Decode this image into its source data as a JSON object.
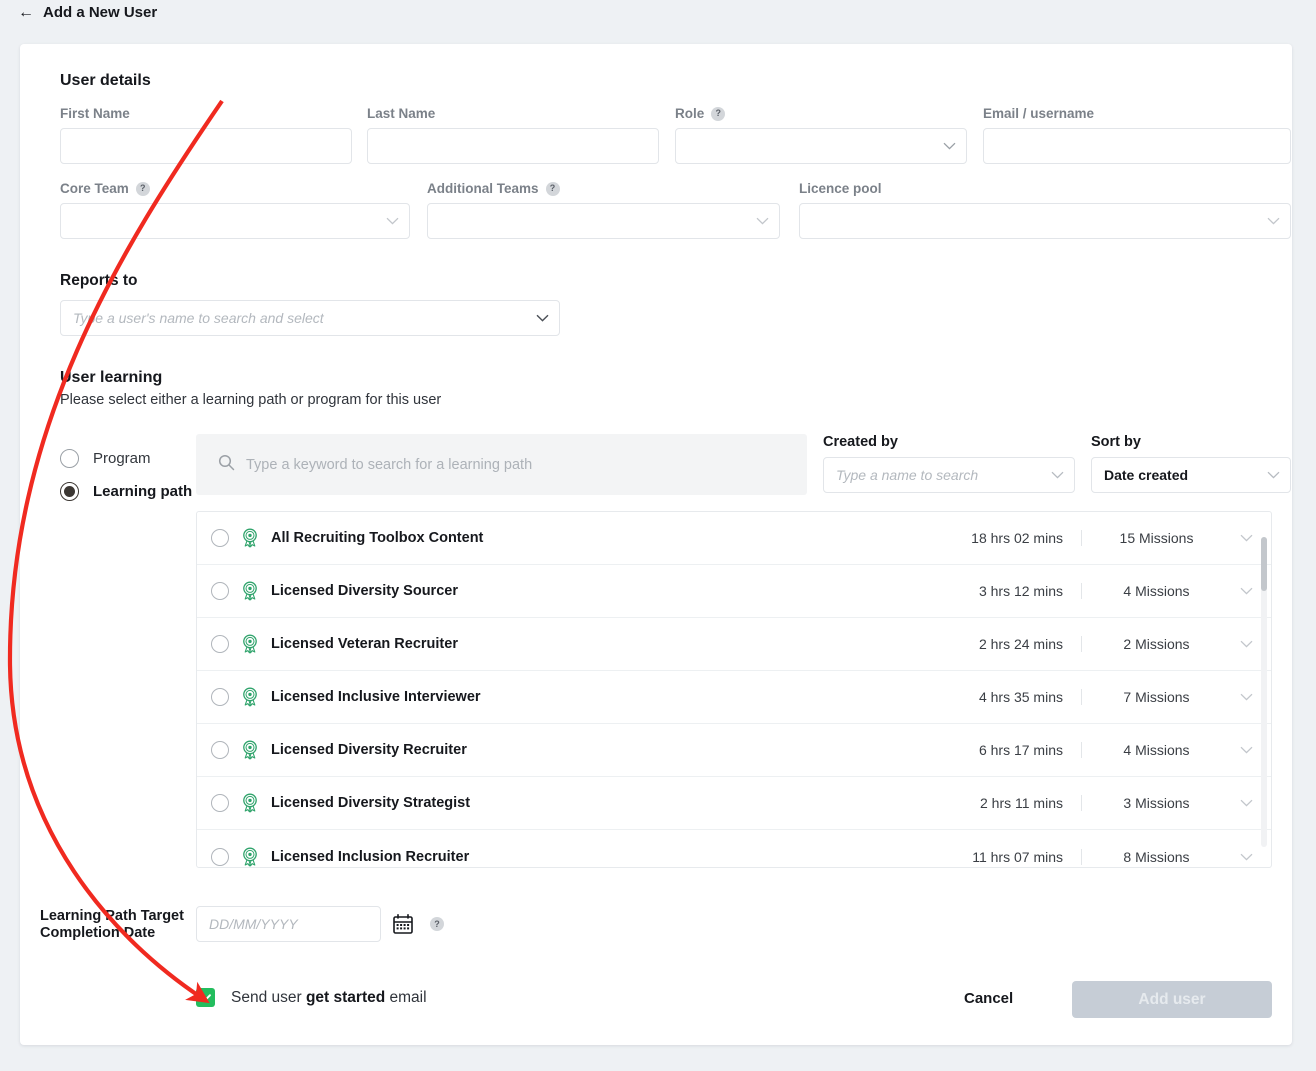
{
  "header": {
    "back_icon": "left-arrow-icon",
    "title": "Add a New User"
  },
  "user_details": {
    "section_title": "User details",
    "fields": [
      {
        "label": "First Name",
        "value": "",
        "placeholder": "",
        "type": "text",
        "help": false
      },
      {
        "label": "Last Name",
        "value": "",
        "placeholder": "",
        "type": "text",
        "help": false
      },
      {
        "label": "Role",
        "value": "",
        "placeholder": "",
        "type": "select",
        "help": true
      },
      {
        "label": "Email / username",
        "value": "",
        "placeholder": "",
        "type": "text",
        "help": false
      },
      {
        "label": "Core Team",
        "value": "",
        "placeholder": "",
        "type": "select",
        "help": true
      },
      {
        "label": "Additional Teams",
        "value": "",
        "placeholder": "",
        "type": "select",
        "help": true
      },
      {
        "label": "Licence pool",
        "value": "",
        "placeholder": "",
        "type": "select",
        "help": false
      }
    ]
  },
  "reports_to": {
    "label": "Reports to",
    "value": "",
    "placeholder": "Type a user's name to search and select"
  },
  "user_learning": {
    "section_title": "User learning",
    "subtitle": "Please select either a learning path or program for this user",
    "options": [
      {
        "label": "Program",
        "selected": false
      },
      {
        "label": "Learning path",
        "selected": true
      }
    ],
    "search": {
      "icon": "search-icon",
      "value": "",
      "placeholder": "Type a keyword to search for a learning path"
    },
    "created_by": {
      "label": "Created by",
      "value": "",
      "placeholder": "Type a name to search"
    },
    "sort_by": {
      "label": "Sort by",
      "value": "Date created"
    },
    "paths": [
      {
        "name": "All Recruiting Toolbox Content",
        "duration": "18 hrs 02 mins",
        "missions": "15 Missions",
        "selected": false
      },
      {
        "name": "Licensed Diversity Sourcer",
        "duration": "3 hrs 12 mins",
        "missions": "4 Missions",
        "selected": false
      },
      {
        "name": "Licensed Veteran Recruiter",
        "duration": "2 hrs 24 mins",
        "missions": "2 Missions",
        "selected": false
      },
      {
        "name": "Licensed Inclusive Interviewer",
        "duration": "4 hrs 35 mins",
        "missions": "7 Missions",
        "selected": false
      },
      {
        "name": "Licensed Diversity Recruiter",
        "duration": "6 hrs 17 mins",
        "missions": "4 Missions",
        "selected": false
      },
      {
        "name": "Licensed Diversity Strategist",
        "duration": "2 hrs 11 mins",
        "missions": "3 Missions",
        "selected": false
      },
      {
        "name": "Licensed Inclusion Recruiter",
        "duration": "11 hrs 07 mins",
        "missions": "8 Missions",
        "selected": false
      }
    ]
  },
  "target_date": {
    "label": "Learning Path Target Completion Date",
    "value": "",
    "placeholder": "DD/MM/YYYY",
    "calendar_icon": "calendar-icon",
    "help_icon": "question-mark-icon"
  },
  "footer": {
    "send_email_checked": true,
    "send_email_prefix": "Send user ",
    "send_email_bold": "get started",
    "send_email_suffix": " email",
    "cancel_label": "Cancel",
    "submit_label": "Add user"
  },
  "colors": {
    "page_background": "#eef1f4",
    "card_background": "#ffffff",
    "badge_green": "#2fa36b",
    "checkbox_green": "#23bd5e",
    "submit_disabled": "#c6cdd6",
    "annotation_red": "#f02a20"
  },
  "annotation": {
    "shape": "curved-arrow",
    "from": "first-name-field",
    "to": "send-get-started-email-checkbox"
  }
}
